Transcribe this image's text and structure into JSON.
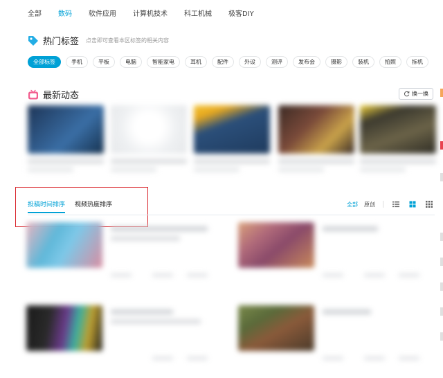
{
  "topnav": {
    "items": [
      {
        "label": "全部",
        "active": false
      },
      {
        "label": "数码",
        "active": true
      },
      {
        "label": "软件应用",
        "active": false
      },
      {
        "label": "计算机技术",
        "active": false
      },
      {
        "label": "科工机械",
        "active": false
      },
      {
        "label": "极客DIY",
        "active": false
      }
    ]
  },
  "hot_tags": {
    "title": "热门标签",
    "hint": "点击即可查看本区标签的相关内容",
    "icon": "tag-icon",
    "tags": [
      {
        "label": "全部标签",
        "active": true
      },
      {
        "label": "手机",
        "active": false
      },
      {
        "label": "平板",
        "active": false
      },
      {
        "label": "电脑",
        "active": false
      },
      {
        "label": "智能家电",
        "active": false
      },
      {
        "label": "耳机",
        "active": false
      },
      {
        "label": "配件",
        "active": false
      },
      {
        "label": "外设",
        "active": false
      },
      {
        "label": "测评",
        "active": false
      },
      {
        "label": "发布会",
        "active": false
      },
      {
        "label": "摄影",
        "active": false
      },
      {
        "label": "装机",
        "active": false
      },
      {
        "label": "拍照",
        "active": false
      },
      {
        "label": "拆机",
        "active": false
      }
    ]
  },
  "latest": {
    "title": "最新动态",
    "icon": "tv-icon",
    "refresh_label": "换一换"
  },
  "sort": {
    "tabs": [
      {
        "label": "投稿时间排序",
        "active": true
      },
      {
        "label": "视频热度排序",
        "active": false
      }
    ],
    "filters": [
      {
        "label": "全部",
        "active": true
      },
      {
        "label": "原创",
        "active": false
      }
    ],
    "views": [
      "list-view-icon",
      "grid-view-icon",
      "small-grid-view-icon"
    ]
  },
  "colors": {
    "accent": "#00a1d6",
    "highlight": "#d9262c",
    "tag_icon": "#23ade5",
    "tv_icon": "#f25d8e"
  }
}
